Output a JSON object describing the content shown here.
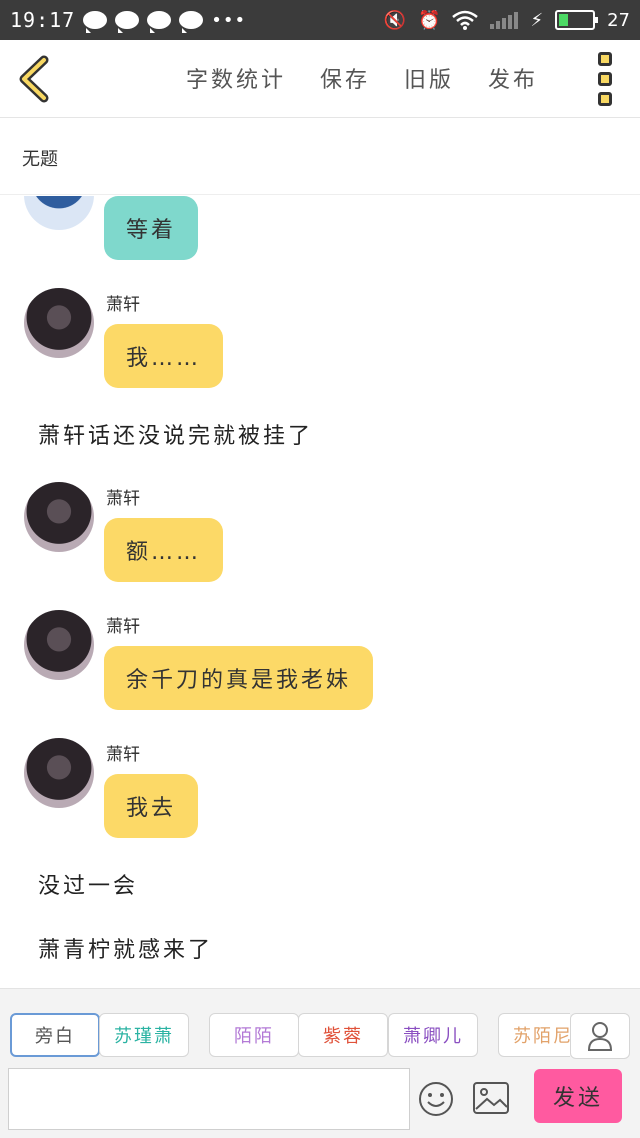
{
  "status_bar": {
    "time": "19:17",
    "battery_text": "27",
    "battery_level_percent": 27,
    "icons": [
      "chat-bubble-icon",
      "chat-bubble-icon",
      "chat-bubble-icon",
      "chat-bubble-icon",
      "more-dots",
      "mute-icon",
      "alarm-icon",
      "wifi-icon",
      "signal-icon",
      "charging-icon",
      "battery-icon"
    ]
  },
  "toolbar": {
    "back_icon": "chevron-left-icon",
    "word_count": "字数统计",
    "save": "保存",
    "old_version": "旧版",
    "publish": "发布",
    "more_icon": "menu-vertical-icon"
  },
  "document": {
    "title": "无题"
  },
  "messages": [
    {
      "type": "bubble",
      "avatar": "blue",
      "name": "",
      "text": "等着",
      "color": "#7fd8cc"
    },
    {
      "type": "bubble",
      "avatar": "dark",
      "name": "萧轩",
      "text": "我……",
      "color": "#fcd967"
    },
    {
      "type": "narration",
      "text": "萧轩话还没说完就被挂了"
    },
    {
      "type": "bubble",
      "avatar": "dark",
      "name": "萧轩",
      "text": "额……",
      "color": "#fcd967"
    },
    {
      "type": "bubble",
      "avatar": "dark",
      "name": "萧轩",
      "text": "余千刀的真是我老妹",
      "color": "#fcd967"
    },
    {
      "type": "bubble",
      "avatar": "dark",
      "name": "萧轩",
      "text": "我去",
      "color": "#fcd967"
    },
    {
      "type": "narration",
      "text": "没过一会"
    },
    {
      "type": "narration",
      "text": "萧青柠就感来了"
    }
  ],
  "characters": [
    {
      "name": "旁白",
      "color": "#555555",
      "active": true
    },
    {
      "name": "苏瑾萧",
      "color": "#2bb3a3",
      "active": false
    },
    {
      "name": "陌陌",
      "color": "#b37ad6",
      "active": false
    },
    {
      "name": "紫蓉",
      "color": "#e0523a",
      "active": false
    },
    {
      "name": "萧卿儿",
      "color": "#8a4fc1",
      "active": false
    },
    {
      "name": "苏陌尼",
      "color": "#e2a26a",
      "active": false
    }
  ],
  "input": {
    "placeholder": "",
    "value": ""
  },
  "buttons": {
    "send": "发送"
  },
  "colors": {
    "accent_pink": "#ff5aa0",
    "bubble_yellow": "#fcd967",
    "bubble_teal": "#7fd8cc",
    "selected_border": "#6a9ad6"
  }
}
